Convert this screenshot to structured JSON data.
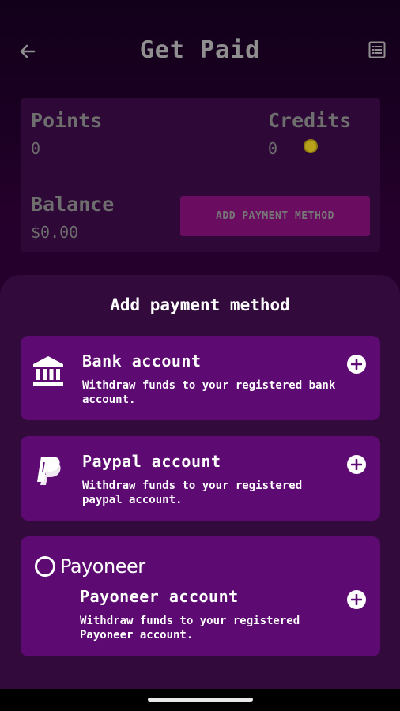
{
  "header": {
    "title": "Get Paid",
    "back_icon": "arrow-left-icon",
    "history_icon": "list-icon"
  },
  "summary": {
    "points_label": "Points",
    "points_value": "0",
    "credits_label": "Credits",
    "credits_value": "0",
    "balance_label": "Balance",
    "balance_value": "$0.00",
    "add_payment_label": "ADD PAYMENT METHOD"
  },
  "sheet": {
    "title": "Add payment method",
    "methods": [
      {
        "icon": "bank-icon",
        "title": "Bank account",
        "desc": "Withdraw funds to your registered bank account."
      },
      {
        "icon": "paypal-icon",
        "title": "Paypal account",
        "desc": "Withdraw funds to your registered paypal account."
      },
      {
        "icon": "payoneer-logo",
        "logo_text": "Payoneer",
        "title": "Payoneer account",
        "desc": "Withdraw funds to your registered Payoneer account."
      }
    ]
  },
  "colors": {
    "card": "#5d0a72",
    "sheet": "#330a3c",
    "button": "#6a0d60"
  }
}
